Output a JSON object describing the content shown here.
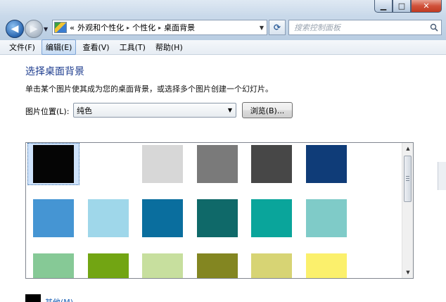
{
  "window": {
    "controls": {
      "minimize": "▁",
      "maximize": "□",
      "close": "✕"
    }
  },
  "nav": {
    "back_icon": "arrow-left-icon",
    "forward_icon": "arrow-right-icon"
  },
  "address": {
    "crumbs": [
      "外观和个性化",
      "个性化",
      "桌面背景"
    ],
    "chevron": "«",
    "separator": "▸"
  },
  "search": {
    "placeholder": "搜索控制面板"
  },
  "menu": {
    "items": [
      {
        "label": "文件(F)",
        "active": false
      },
      {
        "label": "编辑(E)",
        "active": true
      },
      {
        "label": "查看(V)",
        "active": false
      },
      {
        "label": "工具(T)",
        "active": false
      },
      {
        "label": "帮助(H)",
        "active": false
      }
    ]
  },
  "main": {
    "title": "选择桌面背景",
    "subtitle": "单击某个图片使其成为您的桌面背景，或选择多个图片创建一个幻灯片。",
    "location_label": "图片位置(L):",
    "location_value": "纯色",
    "browse_label": "浏览(B)...",
    "other_label": "其他(M)..."
  },
  "colors": {
    "accent": "#1e3d8f",
    "link": "#1a5fb4",
    "swatches": [
      [
        "#050505",
        "#ffffff",
        "#d7d7d7",
        "#7a7a7a",
        "#474747",
        "#0f3c78"
      ],
      [
        "#4595d3",
        "#9fd7ea",
        "#0a6e9e",
        "#0f6969",
        "#0aa59b",
        "#7fcbc8"
      ],
      [
        "#86c996",
        "#72a513",
        "#c7df9e",
        "#838621",
        "#d7d474",
        "#fbf06c"
      ]
    ],
    "selected_swatch": [
      0,
      0
    ]
  }
}
